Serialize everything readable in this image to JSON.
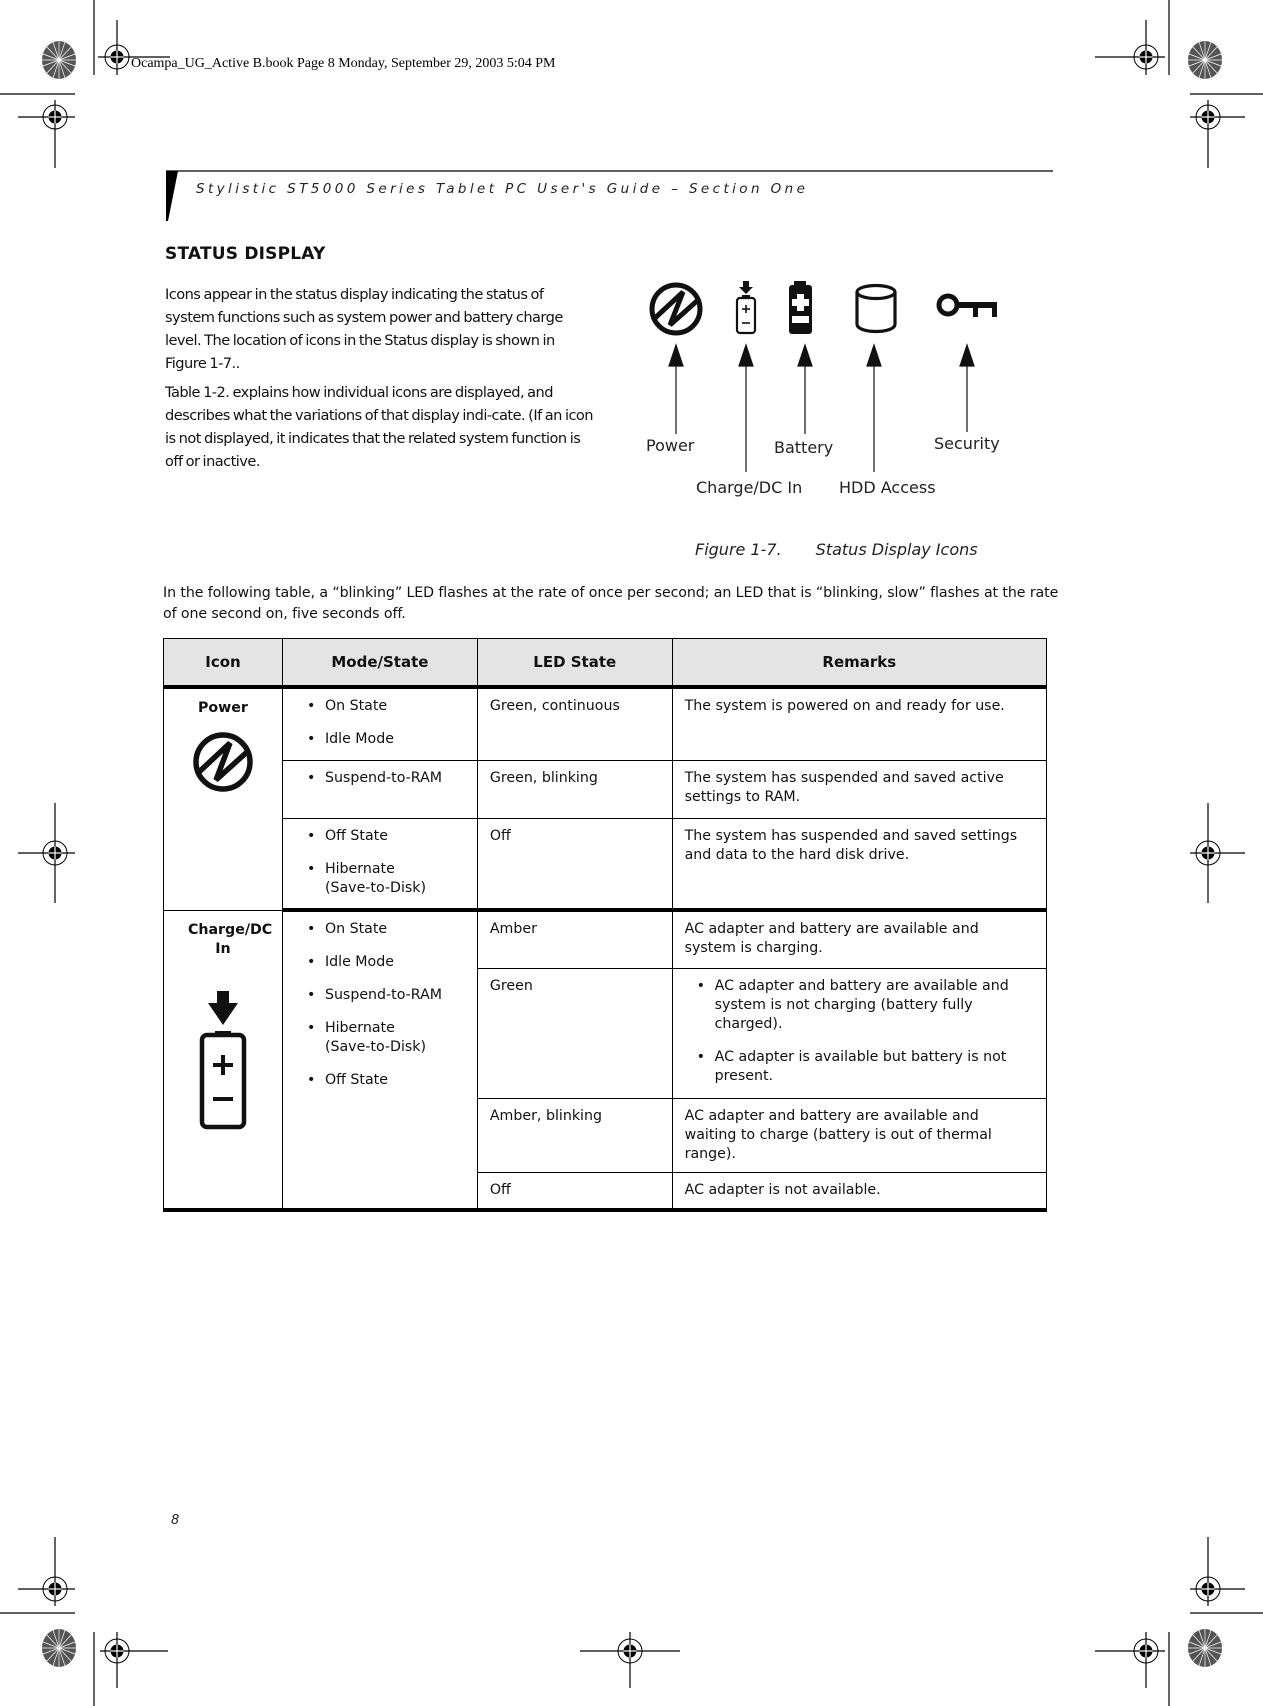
{
  "slug": "Ocampa_UG_Active B.book  Page 8  Monday, September 29, 2003  5:04 PM",
  "running_header": "Stylistic ST5000 Series Tablet PC User's Guide – Section One",
  "section": {
    "heading": "STATUS DISPLAY",
    "paragraphs": [
      "Icons appear in the status display indicating the status of system functions such as system power and battery charge level. The location of icons in the Status display is shown in Figure 1-7..",
      "Table 1-2. explains how individual icons are displayed, and describes what the variations of that display indi-cate. (If an icon is not displayed, it indicates that the related system function is off or inactive."
    ]
  },
  "figure": {
    "icons": [
      {
        "name": "power-icon",
        "label": "Power"
      },
      {
        "name": "charge-dc-in-icon",
        "label": "Charge/DC In"
      },
      {
        "name": "battery-icon",
        "label": "Battery"
      },
      {
        "name": "hdd-access-icon",
        "label": "HDD Access"
      },
      {
        "name": "security-key-icon",
        "label": "Security"
      }
    ],
    "caption_number": "Figure 1-7.",
    "caption_title": "Status Display Icons"
  },
  "table_note": "In the following table, a “blinking” LED flashes at the rate of once per second; an LED that is “blinking, slow” flashes at the rate of one second on, five seconds off.",
  "table": {
    "headers": [
      "Icon",
      "Mode/State",
      "LED State",
      "Remarks"
    ],
    "groups": [
      {
        "icon_label": "Power",
        "icon": "power-icon",
        "rows": [
          {
            "modes": [
              "On State",
              "Idle Mode"
            ],
            "led": "Green, continuous",
            "remarks": "The system is powered on and ready for use."
          },
          {
            "modes": [
              "Suspend-to-RAM"
            ],
            "led": "Green, blinking",
            "remarks": "The system has suspended and saved active settings to RAM."
          },
          {
            "modes": [
              "Off State",
              "Hibernate (Save-to-Disk)"
            ],
            "led": "Off",
            "remarks": "The system has suspended and saved settings and data to the hard disk drive."
          }
        ]
      },
      {
        "icon_label": "Charge/DC In",
        "icon": "charge-dc-in-icon",
        "modes": [
          "On State",
          "Idle Mode",
          "Suspend-to-RAM",
          "Hibernate (Save-to-Disk)",
          "Off State"
        ],
        "rows": [
          {
            "led": "Amber",
            "remarks": "AC adapter and battery are available and system is charging."
          },
          {
            "led": "Green",
            "remarks_list": [
              "AC adapter and battery are available and system is not charging (battery fully charged).",
              "AC adapter is available but battery is not present."
            ]
          },
          {
            "led": "Amber, blinking",
            "remarks": "AC adapter and battery are available and waiting to charge (battery is out of thermal range)."
          },
          {
            "led": "Off",
            "remarks": "AC adapter is not available."
          }
        ]
      }
    ]
  },
  "page_number": "8"
}
